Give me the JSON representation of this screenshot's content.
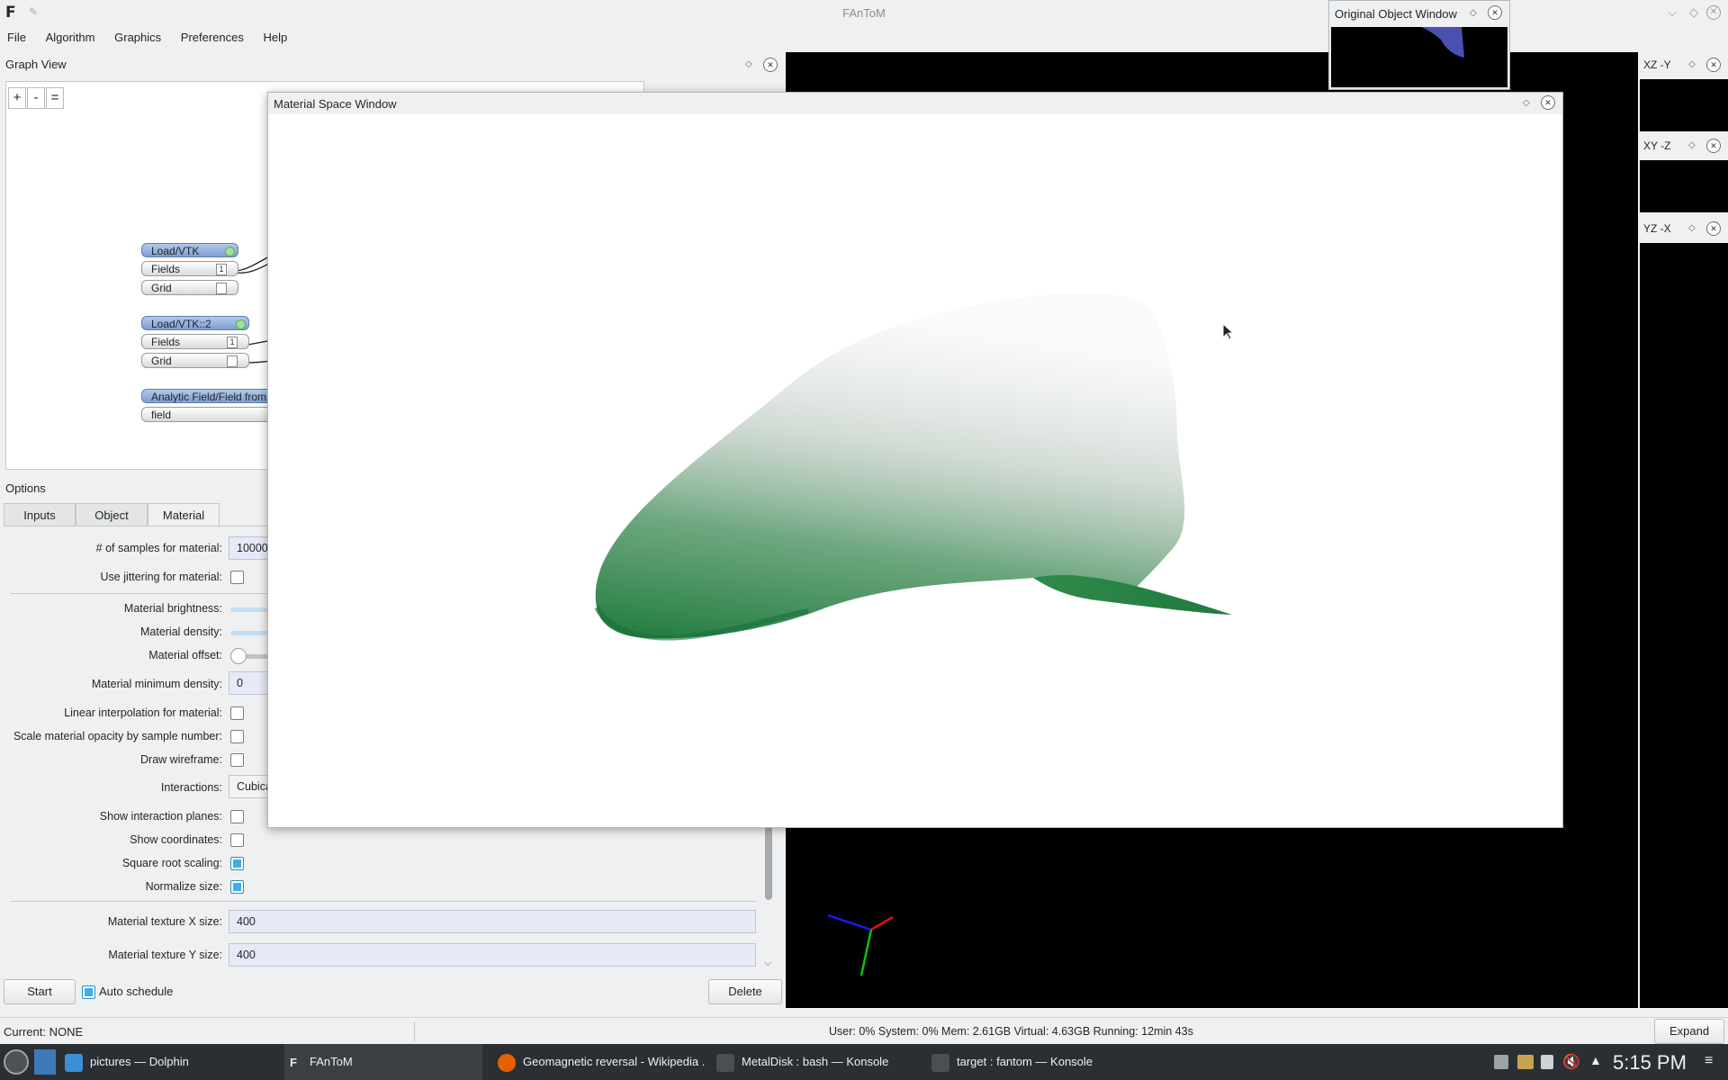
{
  "app": {
    "title": "FAnToM",
    "logo": "F"
  },
  "menubar": [
    "File",
    "Algorithm",
    "Graphics",
    "Preferences",
    "Help"
  ],
  "graph_view": {
    "title": "Graph View",
    "zoom": [
      "+",
      "-",
      "="
    ],
    "nodes": [
      {
        "head": "Load/VTK",
        "ports": [
          {
            "label": "Fields",
            "badge": "1"
          },
          {
            "label": "Grid",
            "badge": ""
          }
        ]
      },
      {
        "head": "Load/VTK::2",
        "ports": [
          {
            "label": "Fields",
            "badge": "1"
          },
          {
            "label": "Grid",
            "badge": ""
          }
        ]
      },
      {
        "head": "Analytic Field/Field from",
        "ports": [
          {
            "label": "field",
            "badge": ""
          }
        ]
      }
    ]
  },
  "options": {
    "title": "Options",
    "tabs": [
      "Inputs",
      "Object",
      "Material"
    ],
    "active_tab": "Material",
    "rows": {
      "samples": {
        "label": "# of samples for material:",
        "value": "10000"
      },
      "jitter": {
        "label": "Use jittering for material:",
        "checked": false
      },
      "brightness": {
        "label": "Material brightness:"
      },
      "density": {
        "label": "Material density:"
      },
      "offset": {
        "label": "Material offset:"
      },
      "min_density": {
        "label": "Material minimum density:",
        "value": "0"
      },
      "linear": {
        "label": "Linear interpolation for material:",
        "checked": false
      },
      "scale_opacity": {
        "label": "Scale material opacity by sample number:",
        "checked": false
      },
      "wireframe": {
        "label": "Draw wireframe:",
        "checked": false
      },
      "interactions": {
        "label": "Interactions:",
        "value": "Cubica"
      },
      "planes": {
        "label": "Show interaction planes:",
        "checked": false
      },
      "coords": {
        "label": "Show coordinates:",
        "checked": false
      },
      "sqrt": {
        "label": "Square root scaling:",
        "checked": true
      },
      "normalize": {
        "label": "Normalize size:",
        "checked": true
      },
      "tex_x": {
        "label": "Material texture X size:",
        "value": "400"
      },
      "tex_y": {
        "label": "Material texture Y size:",
        "value": "400"
      }
    },
    "start_label": "Start",
    "auto_schedule_label": "Auto schedule",
    "auto_schedule_checked": true,
    "delete_label": "Delete"
  },
  "material_window": {
    "title": "Material Space Window"
  },
  "original_window": {
    "title": "Original Object Window"
  },
  "side_views": [
    {
      "title": "XZ -Y"
    },
    {
      "title": "XY -Z"
    },
    {
      "title": "YZ -X"
    }
  ],
  "status": {
    "current": "Current: NONE",
    "stats": "User: 0% System: 0%  Mem: 2.61GB Virtual: 4.63GB Running: 12min 43s",
    "expand": "Expand"
  },
  "taskbar": {
    "tasks": [
      {
        "label": "pictures — Dolphin"
      },
      {
        "label": "FAnToM"
      },
      {
        "label": "Geomagnetic reversal - Wikipedia ..."
      },
      {
        "label": "MetalDisk : bash — Konsole"
      },
      {
        "label": "target : fantom — Konsole"
      }
    ],
    "clock": "5:15 PM"
  },
  "colors": {
    "accent": "#3daee9",
    "node_blue": "#7c9ed4",
    "surface_green": "#1e7a3c",
    "taskbar": "#2b2f33"
  }
}
